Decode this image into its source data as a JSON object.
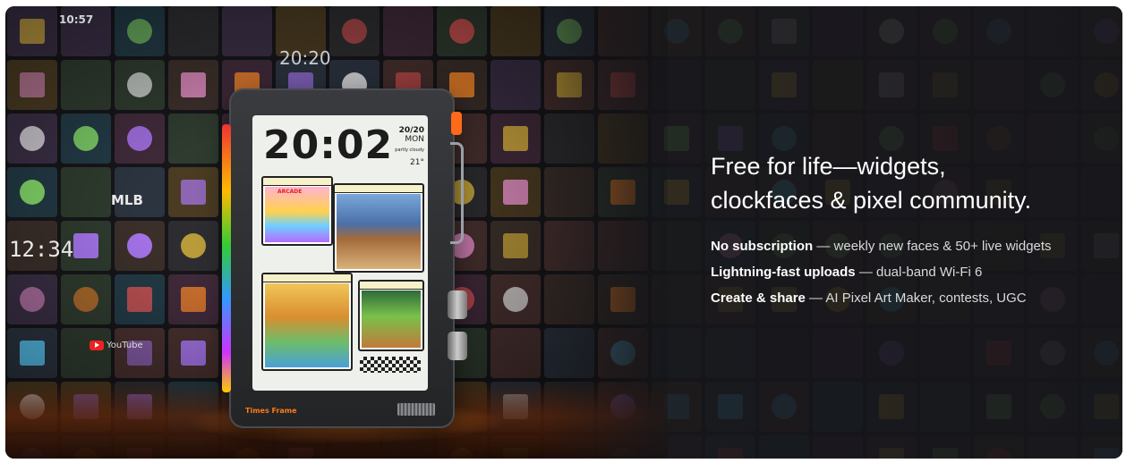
{
  "banner": {
    "headline_line1": "Free for life—widgets,",
    "headline_line2": "clockfaces & pixel community.",
    "features": [
      {
        "title": "No subscription",
        "sep": " — ",
        "detail": "weekly new faces & 50+ live widgets"
      },
      {
        "title": "Lightning-fast uploads",
        "sep": " — ",
        "detail": "dual-band Wi-Fi 6"
      },
      {
        "title": "Create & share",
        "sep": " — ",
        "detail": "AI Pixel Art Maker, contests, UGC"
      }
    ]
  },
  "device": {
    "clock_time": "20:02",
    "date": "20/20",
    "weekday": "MON",
    "weather": "partly cloudy",
    "temperature": "21°",
    "brand_label": "Times Frame",
    "widget_label": "ARCADE"
  },
  "wall_tiles": {
    "tile_time_1": "10:57",
    "tile_time_2": "20:20",
    "tile_time_3": "12:34",
    "tile_logo_1": "MLB",
    "tile_logo_2": "YouTube"
  },
  "colors": {
    "accent_orange": "#ff7a1a",
    "text_white": "#ffffff",
    "text_muted": "#d9d9dc",
    "bg_dark": "#16161a"
  }
}
